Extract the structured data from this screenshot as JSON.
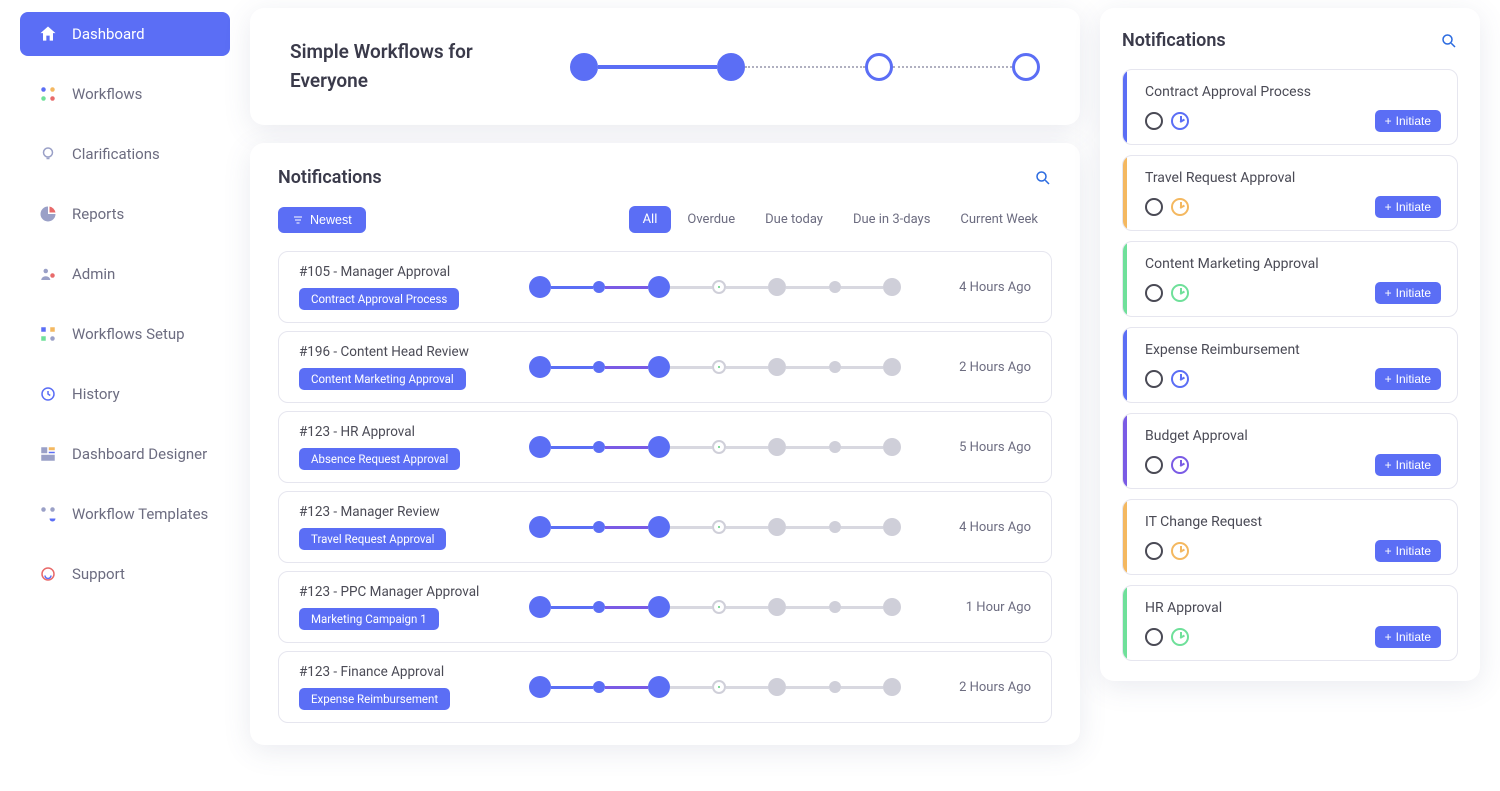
{
  "sidebar": {
    "items": [
      {
        "label": "Dashboard",
        "active": true
      },
      {
        "label": "Workflows"
      },
      {
        "label": "Clarifications"
      },
      {
        "label": "Reports"
      },
      {
        "label": "Admin"
      },
      {
        "label": "Workflows Setup"
      },
      {
        "label": "History"
      },
      {
        "label": "Dashboard Designer"
      },
      {
        "label": "Workflow Templates"
      },
      {
        "label": "Support"
      }
    ]
  },
  "hero": {
    "title": "Simple Workflows for Everyone"
  },
  "notifications": {
    "title": "Notifications",
    "sort_label": "Newest",
    "tabs": [
      "All",
      "Overdue",
      "Due today",
      "Due in 3-days",
      "Current Week"
    ],
    "tasks": [
      {
        "title": "#105 - Manager Approval",
        "badge": "Contract Approval Process",
        "time": "4 Hours Ago"
      },
      {
        "title": "#196 - Content Head Review",
        "badge": "Content Marketing Approval",
        "time": "2 Hours Ago"
      },
      {
        "title": "#123 - HR Approval",
        "badge": "Absence Request Approval",
        "time": "5 Hours Ago"
      },
      {
        "title": "#123 - Manager Review",
        "badge": "Travel Request Approval",
        "time": "4 Hours Ago"
      },
      {
        "title": "#123 - PPC Manager Approval",
        "badge": "Marketing Campaign 1",
        "time": "1 Hour Ago"
      },
      {
        "title": "#123 - Finance Approval",
        "badge": "Expense Reimbursement",
        "time": "2 Hours Ago"
      }
    ]
  },
  "right_panel": {
    "title": "Notifications",
    "initiate_label": "Initiate",
    "workflows": [
      {
        "title": "Contract Approval Process",
        "accent": "#5b6ef5",
        "clock": "#5b6ef5"
      },
      {
        "title": "Travel Request Approval",
        "accent": "#f4b860",
        "clock": "#f4b860"
      },
      {
        "title": "Content Marketing Approval",
        "accent": "#6fe09a",
        "clock": "#6fe09a"
      },
      {
        "title": "Expense Reimbursement",
        "accent": "#5b6ef5",
        "clock": "#5b6ef5"
      },
      {
        "title": "Budget Approval",
        "accent": "#7a5be5",
        "clock": "#7a5be5"
      },
      {
        "title": "IT Change Request",
        "accent": "#f4b860",
        "clock": "#f4b860"
      },
      {
        "title": "HR Approval",
        "accent": "#6fe09a",
        "clock": "#6fe09a"
      }
    ]
  }
}
